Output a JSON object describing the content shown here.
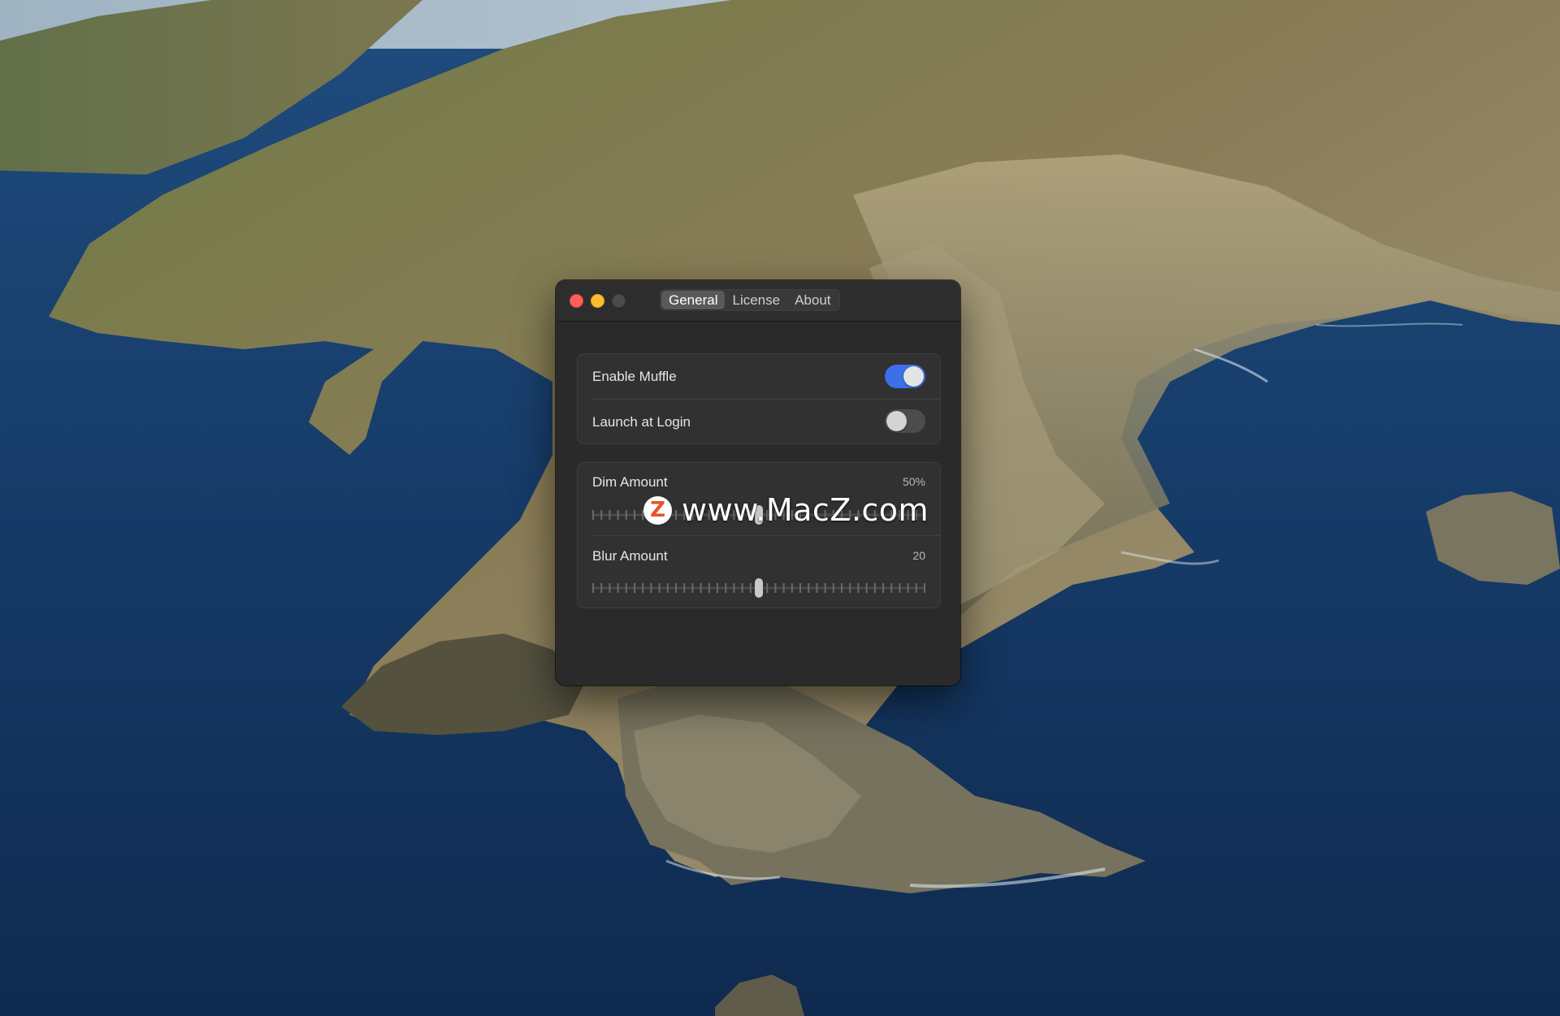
{
  "window": {
    "tabs": [
      {
        "label": "General",
        "active": true
      },
      {
        "label": "License",
        "active": false
      },
      {
        "label": "About",
        "active": false
      }
    ]
  },
  "general": {
    "toggles": [
      {
        "label": "Enable Muffle",
        "on": true
      },
      {
        "label": "Launch at Login",
        "on": false
      }
    ],
    "sliders": [
      {
        "label": "Dim Amount",
        "value_text": "50%",
        "fraction": 0.5
      },
      {
        "label": "Blur Amount",
        "value_text": "20",
        "fraction": 0.5
      }
    ]
  },
  "watermark": {
    "logo_letter": "Z",
    "text": "www.MacZ.com"
  },
  "colors": {
    "accent": "#3b70e8",
    "close": "#ff5f57",
    "minimize": "#febc2e",
    "window_bg": "#2b2a2a"
  },
  "icons": [
    "close-traffic-light",
    "minimize-traffic-light",
    "zoom-traffic-light",
    "z-logo-icon"
  ]
}
